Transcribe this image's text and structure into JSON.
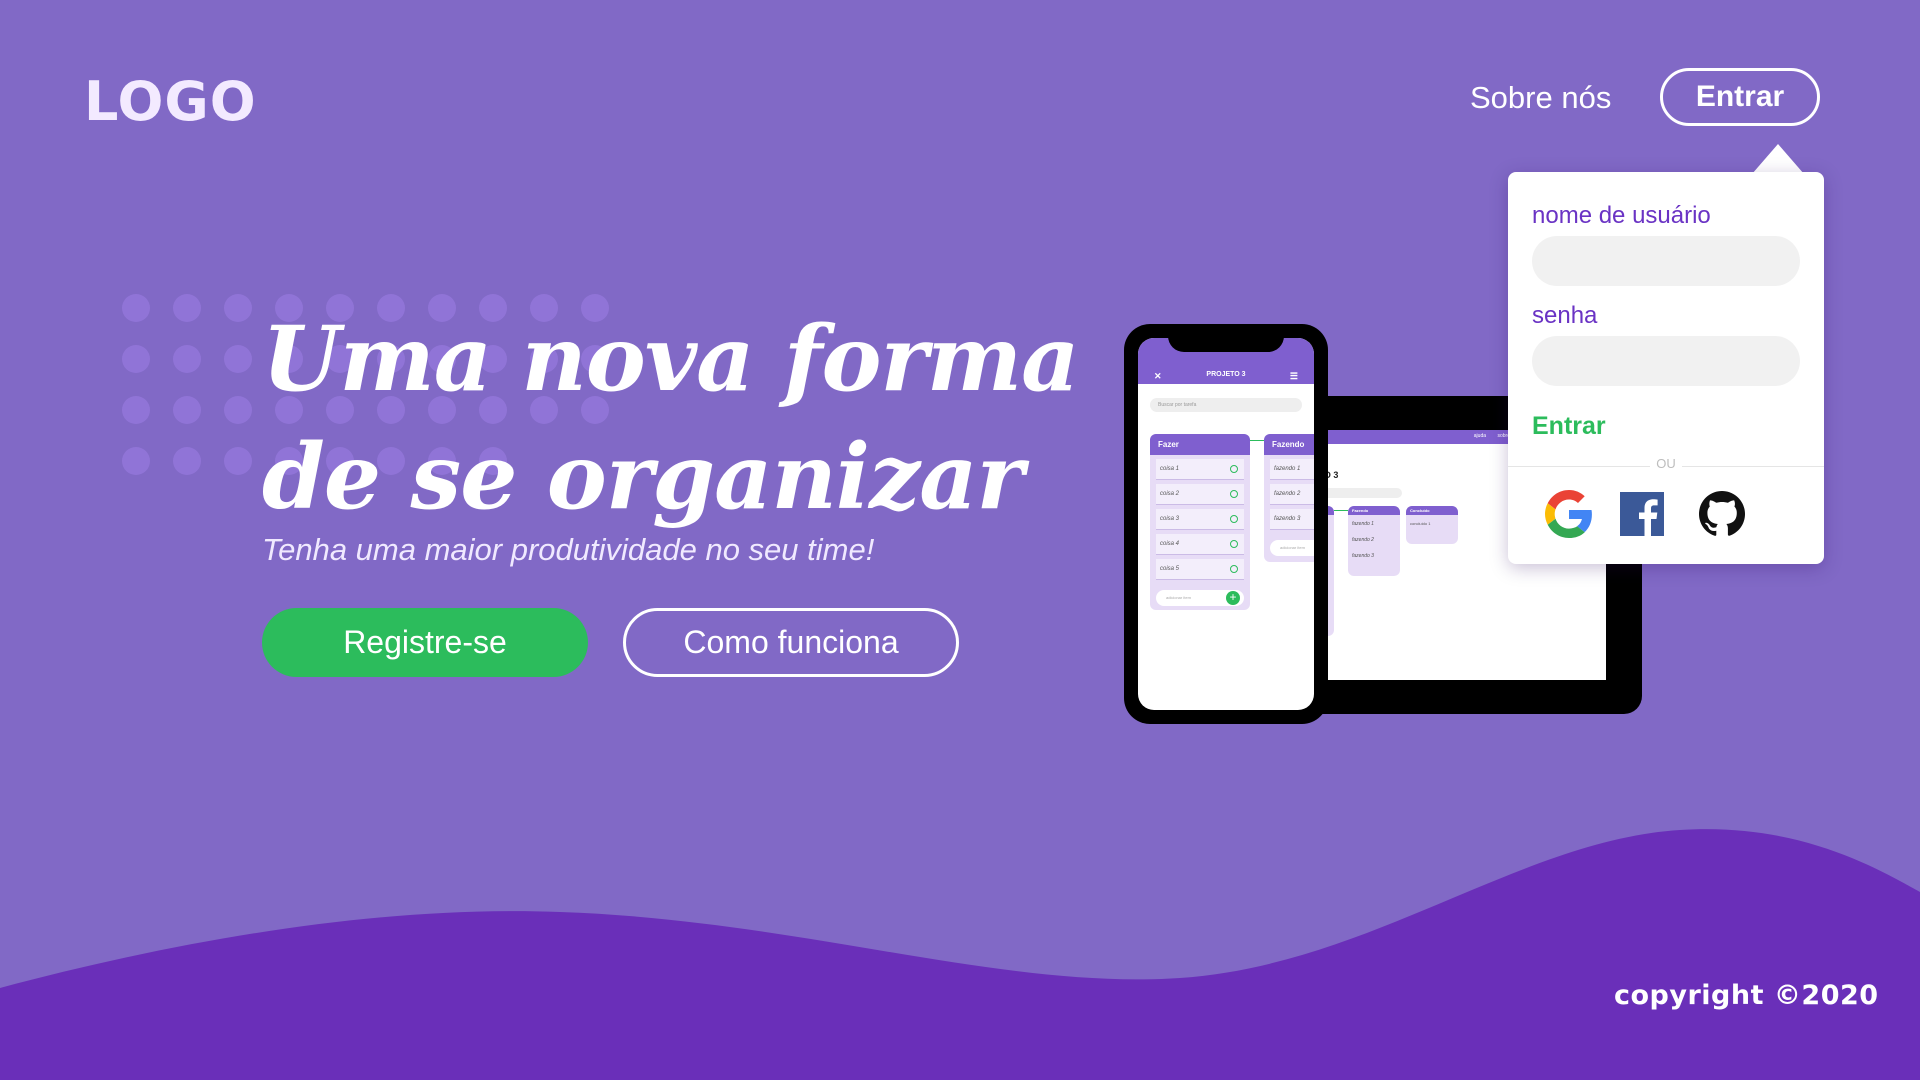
{
  "header": {
    "logo": "LOGO",
    "about_label": "Sobre nós",
    "login_label": "Entrar"
  },
  "hero": {
    "title_line1": "Uma nova forma",
    "title_line2": "de se organizar",
    "subtitle": "Tenha uma maior produtividade no seu time!",
    "register_label": "Registre-se",
    "how_label": "Como funciona"
  },
  "login_dropdown": {
    "username_label": "nome de usuário",
    "username_value": "",
    "password_label": "senha",
    "password_value": "",
    "submit_label": "Entrar",
    "or_label": "OU",
    "social": [
      {
        "name": "google",
        "icon": "google-icon"
      },
      {
        "name": "facebook",
        "icon": "facebook-icon"
      },
      {
        "name": "github",
        "icon": "github-icon"
      }
    ]
  },
  "phone_mockup": {
    "project_title": "PROJETO 3",
    "search_placeholder": "Buscar por tarefa",
    "columns": [
      {
        "title": "Fazer",
        "items": [
          "coisa 1",
          "coisa 2",
          "coisa 3",
          "coisa 4",
          "coisa 5"
        ],
        "add_placeholder": "adicionar item"
      },
      {
        "title": "Fazendo",
        "items": [
          "fazendo 1",
          "fazendo 2",
          "fazendo 3"
        ],
        "add_placeholder": "adicionar item"
      }
    ]
  },
  "tablet_mockup": {
    "project_title": "PROJETO 3",
    "nav": [
      "ajuda",
      "sobre"
    ],
    "columns": [
      {
        "title": "Fazer",
        "items": [
          "coisa 1",
          "coisa 2",
          "coisa 3",
          "coisa 4",
          "coisa 5"
        ]
      },
      {
        "title": "Fazendo",
        "items": [
          "fazendo 1",
          "fazendo 2",
          "fazendo 3"
        ]
      },
      {
        "title": "Concluído",
        "items": [
          "concluído 1"
        ]
      }
    ]
  },
  "footer": {
    "copyright": "copyright ©2020"
  },
  "colors": {
    "background": "#8169c6",
    "wave": "#6a2fb9",
    "accent_green": "#2cbc5c",
    "label_purple": "#6a33c4"
  }
}
